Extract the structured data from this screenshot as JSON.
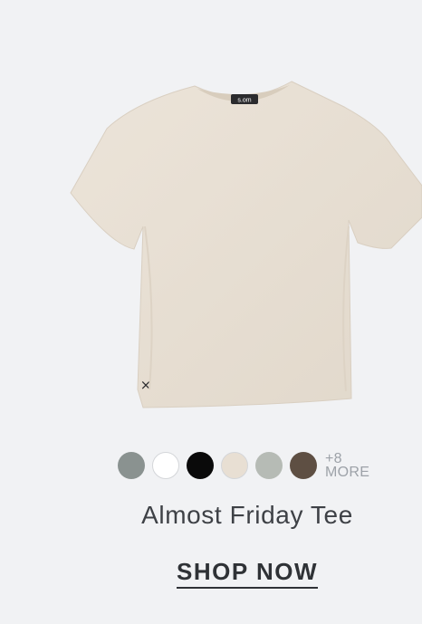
{
  "product": {
    "title": "Almost Friday Tee",
    "image_alt": "tee",
    "neck_label_text": "s.om",
    "mark_glyph": "×"
  },
  "swatches": [
    {
      "name": "slate green",
      "color": "#8a9290"
    },
    {
      "name": "white",
      "color": "#ffffff"
    },
    {
      "name": "black",
      "color": "#0a0a0a"
    },
    {
      "name": "bone",
      "color": "#e8dfd3"
    },
    {
      "name": "sage grey",
      "color": "#b6bbb5"
    },
    {
      "name": "brown",
      "color": "#5e4f43"
    }
  ],
  "more": {
    "count": "+8",
    "label": "MORE"
  },
  "cta": {
    "label": "SHOP NOW"
  },
  "colors": {
    "background": "#f1f2f4",
    "tee": "#e8dfd3"
  }
}
